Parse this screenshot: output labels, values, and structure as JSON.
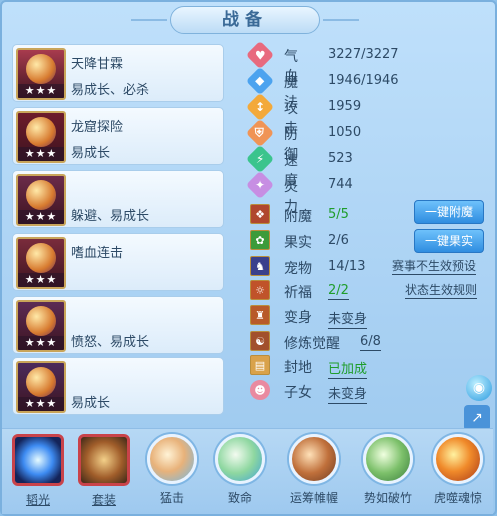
{
  "window": {
    "title": "战备"
  },
  "items": [
    {
      "name": "天降甘霖",
      "desc": "易成长、必杀",
      "stars": "★★★",
      "color": "#a83b4e"
    },
    {
      "name": "龙窟探险",
      "desc": "易成长",
      "stars": "★★★",
      "color": "#6e1b2b"
    },
    {
      "name": "",
      "desc": "躲避、易成长",
      "stars": "★★★",
      "color": "#6b2b4a"
    },
    {
      "name": "嗜血连击",
      "desc": "",
      "stars": "★★★",
      "color": "#7a2c3c"
    },
    {
      "name": "",
      "desc": "愤怒、易成长",
      "stars": "★★★",
      "color": "#5c2b55"
    },
    {
      "name": "",
      "desc": "易成长",
      "stars": "★★★",
      "color": "#4c2b5c"
    }
  ],
  "stats": [
    {
      "label": "气血",
      "value": "3227/3227",
      "icon": "heart-icon",
      "color": "#e86a7e"
    },
    {
      "label": "魔法",
      "value": "1946/1946",
      "icon": "mana-icon",
      "color": "#4ca3ef"
    },
    {
      "label": "攻击",
      "value": "1959",
      "icon": "attack-icon",
      "color": "#f3a93a"
    },
    {
      "label": "防御",
      "value": "1050",
      "icon": "defense-icon",
      "color": "#f09456"
    },
    {
      "label": "速度",
      "value": "523",
      "icon": "speed-icon",
      "color": "#3bc48d"
    },
    {
      "label": "灵力",
      "value": "744",
      "icon": "spirit-icon",
      "color": "#c78ee3"
    }
  ],
  "extras": {
    "fumo": {
      "label": "附魔",
      "value": "5/5"
    },
    "guoshi": {
      "label": "果实",
      "value": "2/6"
    },
    "chongwu": {
      "label": "宠物",
      "value": "14/13"
    },
    "qifu": {
      "label": "祈福",
      "value": "2/2"
    },
    "bianshen": {
      "label": "变身",
      "value": "未变身"
    },
    "xiulian": {
      "label": "修炼觉醒",
      "value": "6/8"
    },
    "fengdi": {
      "label": "封地",
      "value": "已加成"
    },
    "zinv": {
      "label": "子女",
      "value": "未变身"
    }
  },
  "buttons": {
    "one_click_fumo": "一键附魔",
    "one_click_guoshi": "一键果实",
    "match_preset": "赛事不生效预设",
    "state_rule": "状态生效规则"
  },
  "skills": [
    {
      "label": "韬光",
      "icon": "light-orb-icon"
    },
    {
      "label": "套装",
      "icon": "armor-icon"
    },
    {
      "label": "猛击",
      "icon": "fist-strike-icon"
    },
    {
      "label": "致命",
      "icon": "critical-icon"
    },
    {
      "label": "运筹帷幄",
      "icon": "strategy-fist-icon"
    },
    {
      "label": "势如破竹",
      "icon": "sword-icon"
    },
    {
      "label": "虎噬魂惊",
      "icon": "fire-icon"
    }
  ]
}
